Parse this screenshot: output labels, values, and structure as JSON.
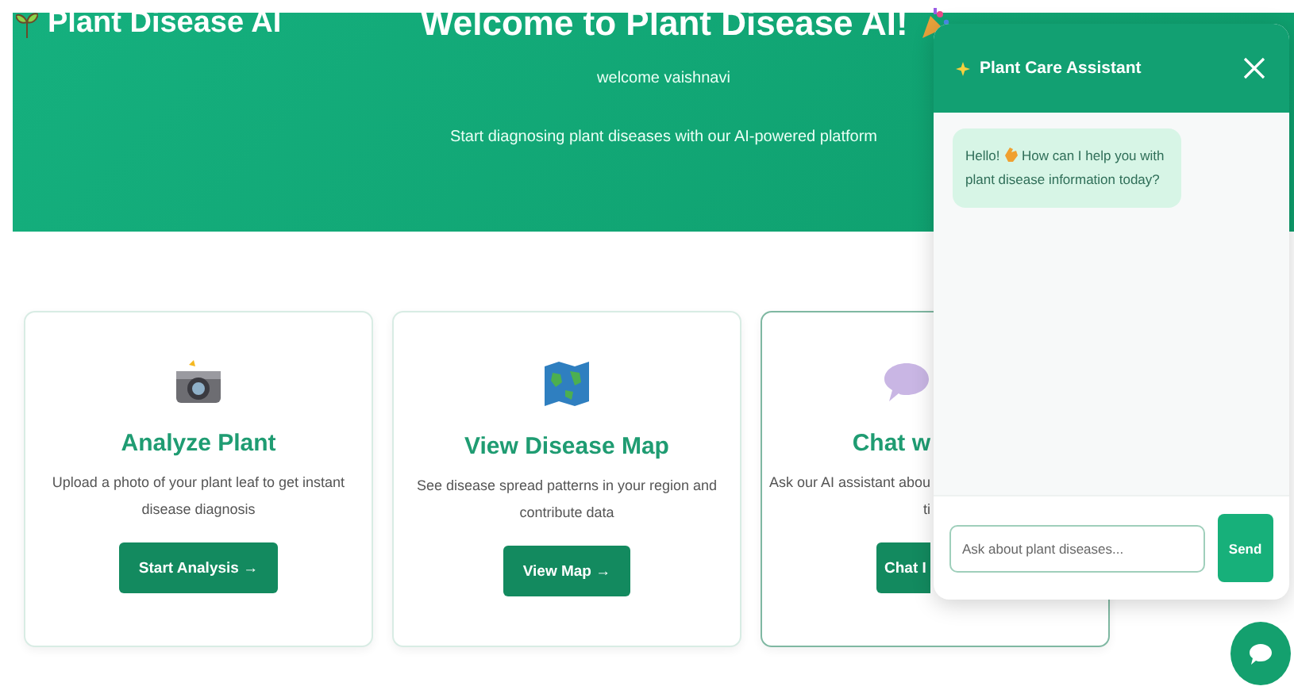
{
  "header": {
    "brand": "Plant Disease AI",
    "title": "Welcome to Plant Disease AI!",
    "greeting": "welcome vaishnavi",
    "subtitle": "Start diagnosing plant diseases with our AI-powered platform"
  },
  "cards": [
    {
      "kind": "camera",
      "title": "Analyze Plant",
      "description": "Upload a photo of your plant leaf to get instant disease diagnosis",
      "button": "Start Analysis →"
    },
    {
      "kind": "map",
      "title": "View Disease Map",
      "description": "See disease spread patterns in your region and contribute data",
      "button": "View Map →"
    },
    {
      "kind": "chat",
      "title": "Chat w",
      "description_lines": [
        "Ask our AI assistant abou",
        "ti"
      ],
      "button": "Chat I"
    }
  ],
  "chat": {
    "title": "Plant Care Assistant",
    "messages": [
      {
        "before": "Hello!",
        "after": "How can I help you with plant disease information today?"
      }
    ],
    "input": {
      "placeholder": "Ask about plant diseases..."
    },
    "send": "Send"
  }
}
